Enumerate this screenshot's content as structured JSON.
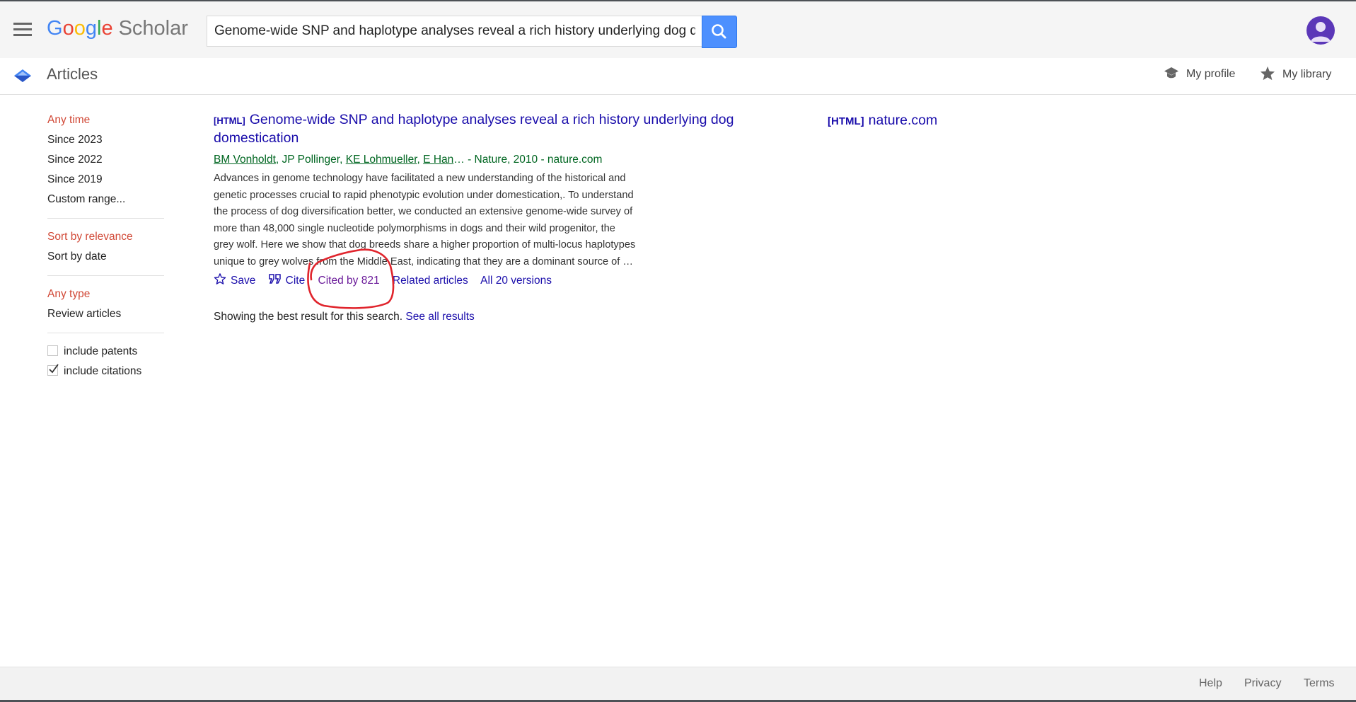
{
  "header": {
    "logo_google": {
      "g1": "G",
      "o1": "o",
      "o2": "o",
      "g2": "g",
      "l": "l",
      "e": "e"
    },
    "logo_scholar": "Scholar",
    "search_value": "Genome-wide SNP and haplotype analyses reveal a rich history underlying dog domestication"
  },
  "subbar": {
    "title": "Articles",
    "my_profile": "My profile",
    "my_library": "My library"
  },
  "sidebar": {
    "time": [
      "Any time",
      "Since 2023",
      "Since 2022",
      "Since 2019",
      "Custom range..."
    ],
    "sort": [
      "Sort by relevance",
      "Sort by date"
    ],
    "type": [
      "Any type",
      "Review articles"
    ],
    "include_patents": "include patents",
    "include_citations": "include citations"
  },
  "result": {
    "tag": "[HTML]",
    "title": "Genome-wide SNP and haplotype analyses reveal a rich history underlying dog domestication",
    "authors": [
      "BM Vonholdt",
      "JP Pollinger",
      "KE Lohmueller",
      "E Han"
    ],
    "author_sep": ", ",
    "ellipsis": "…",
    "source": " - Nature, 2010 - nature.com",
    "snippet_lines": [
      "Advances in genome technology have facilitated a new understanding of the historical and",
      "genetic processes crucial to rapid phenotypic evolution under domestication,. To understand",
      "the process of dog diversification better, we conducted an extensive genome-wide survey of",
      "more than 48,000 single nucleotide polymorphisms in dogs and their wild progenitor, the",
      "grey wolf. Here we show that dog breeds share a higher proportion of multi-locus haplotypes",
      "unique to grey wolves from the Middle East, indicating that they are a dominant source of …"
    ],
    "actions": {
      "save": "Save",
      "cite": "Cite",
      "cited_by": "Cited by 821",
      "related": "Related articles",
      "versions": "All 20 versions"
    }
  },
  "best_result": {
    "text": "Showing the best result for this search.",
    "link": "See all results"
  },
  "side_link": {
    "tag": "[HTML]",
    "domain": "nature.com"
  },
  "footer": {
    "help": "Help",
    "privacy": "Privacy",
    "terms": "Terms"
  },
  "colors": {
    "link": "#1a0dab",
    "visited": "#6b1b9a",
    "meta_green": "#006621",
    "active_red": "#d14836",
    "annotation_red": "#e0242c",
    "search_blue": "#4d90fe"
  }
}
